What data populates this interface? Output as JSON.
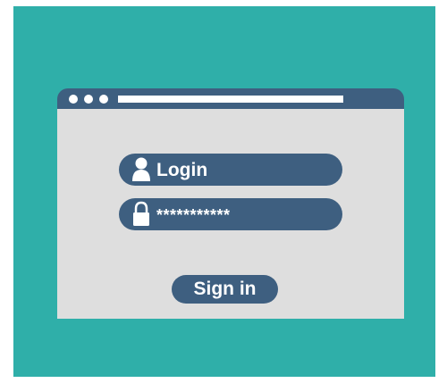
{
  "colors": {
    "background": "#2fafa9",
    "accent": "#3e5f80",
    "window_body": "#dedede",
    "text": "#ffffff"
  },
  "window": {
    "title_bar_dots": [
      "dot",
      "dot",
      "dot"
    ]
  },
  "form": {
    "username": {
      "icon": "user-icon",
      "value": "Login"
    },
    "password": {
      "icon": "lock-icon",
      "value": "***********"
    },
    "submit_label": "Sign in"
  }
}
